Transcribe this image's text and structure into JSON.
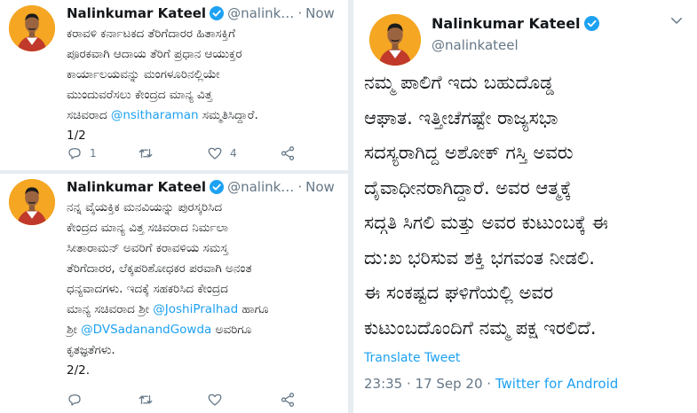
{
  "left_tweets": [
    {
      "name": "Nalinkumar Kateel",
      "handle": "@nalink…",
      "time": "Now",
      "lines": [
        "ಕರಾವಳಿ ಕರ್ನಾಟಕದ ತೆರಿಗೆದಾರರ ಹಿತಾಸಕ್ತಿಗೆ",
        "ಪೂರಕವಾಗಿ ಆದಾಯ ತೆರಿಗೆ ಪ್ರಧಾನ ಆಯುಕ್ತರ",
        "ಕಾರ್ಯಾಲಯವನ್ನು ಮಂಗಳೂರಿನಲ್ಲಿಯೇ",
        "ಮುಂದುವರೆಸಲು ಕೇಂದ್ರದ ಮಾನ್ಯ ವಿತ್ತ",
        "ಸಚಿವರಾದ ",
        "@nsitharaman",
        "  ಸಮ್ಮತಿಸಿದ್ದಾರೆ.",
        "1/2"
      ],
      "reply_count": "1",
      "like_count": "4"
    },
    {
      "name": "Nalinkumar Kateel",
      "handle": "@nalink…",
      "time": "Now",
      "lines": [
        "ನನ್ನ ವೈಯಕ್ತಿಕ ಮನವಿಯನ್ನು ಪುರಸ್ಕರಿಸಿದ",
        "ಕೇಂದ್ರದ ಮಾನ್ಯ ವಿತ್ತ ಸಚಿವರಾದ ನಿರ್ಮಲಾ",
        "ಸೀತಾರಾಮನ್ ಅವರಿಗೆ ಕರಾವಳಿಯ ಸಮಸ್ತ",
        "ತೆರಿಗೆದಾರರ, ಲೆಕ್ಕಪರಿಶೋಧಕರ ಪರವಾಗಿ ಅನಂತ",
        "ಧನ್ಯವಾದಗಳು. ಇದಕ್ಕೆ ಸಹಕರಿಸಿದ ಕೇಂದ್ರದ",
        "ಮಾನ್ಯ ಸಚಿವರಾದ ಶ್ರೀ ",
        "@JoshiPralhad",
        " ಹಾಗೂ",
        "ಶ್ರೀ ",
        "@DVSadanandGowda",
        " ಅವರಿಗೂ",
        "ಕೃತಜ್ಞತೆಗಳು.",
        "2/2."
      ]
    }
  ],
  "right_tweet": {
    "name": "Nalinkumar Kateel",
    "handle": "@nalinkateel",
    "lines": [
      "ನಮ್ಮ ಪಾಲಿಗೆ ಇದು ಬಹುದೊಡ್ಡ",
      "ಆಘಾತ. ಇತ್ತೀಚೆಗಷ್ಟೇ ರಾಜ್ಯಸಭಾ",
      "ಸದಸ್ಯರಾಗಿದ್ದ ಅಶೋಕ್ ಗಸ್ತಿ ಅವರು",
      "ದೈವಾಧೀನರಾಗಿದ್ದಾರೆ. ಅವರ ಆತ್ಮಕ್ಕೆ",
      "ಸದ್ಗತಿ ಸಿಗಲಿ ಮತ್ತು ಅವರ ಕುಟುಂಬಕ್ಕೆ ಈ",
      "ದು:ಖ ಭರಿಸುವ ಶಕ್ತಿ ಭಗವಂತ ನೀಡಲಿ.",
      "ಈ ಸಂಕಷ್ಟದ ಘಳಿಗೆಯಲ್ಲಿ ಅವರ",
      "ಕುಟುಂಬದೊಂದಿಗೆ ನಮ್ಮ ಪಕ್ಷ ಇರಲಿದೆ."
    ],
    "translate_label": "Translate Tweet",
    "timestamp": "23:35 · 17 Sep 20 · ",
    "source": "Twitter for Android"
  },
  "icons": [
    "reply-icon",
    "retweet-icon",
    "like-icon",
    "share-icon",
    "verified-badge-icon",
    "chevron-down-icon"
  ],
  "colors": {
    "link": "#1da1f2",
    "secondary": "#657786",
    "divider": "#e6ecf0",
    "avatar_bg": "#f5a623"
  }
}
